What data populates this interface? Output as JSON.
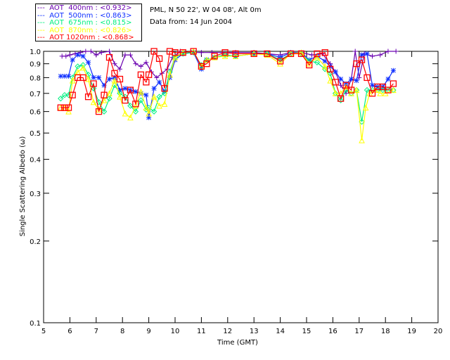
{
  "chart_data": {
    "type": "line",
    "xlabel": "Time (GMT)",
    "ylabel": "Single Scattering Albedo (ω)",
    "xlim": [
      5,
      20
    ],
    "ylim": [
      0.1,
      1.0
    ],
    "yscale": "log",
    "x_ticks": [
      "5",
      "6",
      "7",
      "8",
      "9",
      "10",
      "11",
      "12",
      "13",
      "14",
      "15",
      "16",
      "17",
      "18",
      "19",
      "20"
    ],
    "y_ticks": [
      "0.1",
      "0.2",
      "0.3",
      "0.4",
      "0.5",
      "0.6",
      "0.7",
      "0.8",
      "0.9",
      "1.0"
    ],
    "grid": false,
    "legend_position": "top-left",
    "series": [
      {
        "name": "AOT  400nm : <0.932>",
        "color": "#6a00b0",
        "marker": "plus",
        "x": [
          5.7,
          5.85,
          6.0,
          6.2,
          6.4,
          6.6,
          6.8,
          7.0,
          7.2,
          7.5,
          7.7,
          7.9,
          8.1,
          8.3,
          8.5,
          8.7,
          8.9,
          9.1,
          9.3,
          9.5,
          9.7,
          9.9,
          10.2,
          10.6,
          11.0,
          11.4,
          11.8,
          12.3,
          13.0,
          13.5,
          14.0,
          14.4,
          14.8,
          15.2,
          15.6,
          15.9,
          16.1,
          16.3,
          16.5,
          16.7,
          16.85,
          17.0,
          17.2,
          17.5,
          17.8,
          18.1,
          18.4
        ],
        "y": [
          0.96,
          0.96,
          0.97,
          0.98,
          0.99,
          1.0,
          1.0,
          0.97,
          0.99,
          1.0,
          0.9,
          0.86,
          0.97,
          0.97,
          0.9,
          0.88,
          0.91,
          0.84,
          0.8,
          0.83,
          0.86,
          0.95,
          1.0,
          0.99,
          0.99,
          0.99,
          0.99,
          0.99,
          0.99,
          0.98,
          0.97,
          0.99,
          0.99,
          0.97,
          0.98,
          0.9,
          0.84,
          0.75,
          0.7,
          0.79,
          1.0,
          0.8,
          0.98,
          0.96,
          0.97,
          1.0,
          1.0
        ]
      },
      {
        "name": "AOT  500nm : <0.863>",
        "color": "#1030ff",
        "marker": "asterisk",
        "x": [
          5.65,
          5.8,
          5.95,
          6.1,
          6.3,
          6.5,
          6.7,
          6.9,
          7.1,
          7.3,
          7.5,
          7.7,
          7.9,
          8.1,
          8.3,
          8.5,
          8.7,
          8.9,
          9.0,
          9.2,
          9.4,
          9.6,
          9.8,
          10.0,
          10.3,
          10.7,
          11.0,
          11.2,
          11.5,
          11.9,
          12.3,
          13.0,
          13.5,
          14.0,
          14.4,
          14.8,
          15.1,
          15.4,
          15.7,
          15.9,
          16.1,
          16.3,
          16.5,
          16.7,
          16.9,
          17.1,
          17.3,
          17.5,
          17.7,
          17.9,
          18.1,
          18.3
        ],
        "y": [
          0.81,
          0.81,
          0.81,
          0.93,
          0.97,
          0.96,
          0.91,
          0.8,
          0.8,
          0.75,
          0.79,
          0.8,
          0.72,
          0.73,
          0.72,
          0.71,
          0.7,
          0.69,
          0.57,
          0.73,
          0.77,
          0.71,
          0.8,
          0.93,
          0.98,
          0.99,
          0.86,
          0.93,
          0.95,
          0.97,
          0.96,
          0.98,
          0.98,
          0.95,
          0.99,
          0.99,
          0.93,
          0.96,
          0.92,
          0.88,
          0.84,
          0.79,
          0.76,
          0.79,
          0.78,
          0.97,
          0.98,
          0.75,
          0.74,
          0.74,
          0.79,
          0.85
        ]
      },
      {
        "name": "AOT  675nm : <0.815>",
        "color": "#00f080",
        "marker": "diamond",
        "x": [
          5.65,
          5.8,
          5.95,
          6.1,
          6.3,
          6.5,
          6.7,
          6.9,
          7.1,
          7.3,
          7.5,
          7.7,
          7.9,
          8.1,
          8.3,
          8.5,
          8.7,
          8.9,
          9.0,
          9.2,
          9.4,
          9.6,
          9.8,
          10.0,
          10.3,
          10.7,
          11.0,
          11.2,
          11.5,
          11.9,
          12.3,
          13.0,
          13.5,
          14.0,
          14.4,
          14.8,
          15.1,
          15.4,
          15.7,
          15.9,
          16.1,
          16.3,
          16.5,
          16.7,
          16.9,
          17.1,
          17.3,
          17.5,
          17.7,
          17.9,
          18.1,
          18.3
        ],
        "y": [
          0.67,
          0.69,
          0.69,
          0.8,
          0.88,
          0.89,
          0.82,
          0.73,
          0.65,
          0.6,
          0.67,
          0.75,
          0.7,
          0.68,
          0.63,
          0.6,
          0.66,
          0.61,
          0.62,
          0.6,
          0.68,
          0.7,
          0.84,
          0.95,
          0.98,
          0.99,
          0.89,
          0.93,
          0.95,
          0.97,
          0.96,
          0.98,
          0.98,
          0.93,
          0.98,
          0.98,
          0.92,
          0.91,
          0.86,
          0.83,
          0.7,
          0.66,
          0.72,
          0.7,
          0.72,
          0.55,
          0.72,
          0.72,
          0.72,
          0.72,
          0.72,
          0.72
        ]
      },
      {
        "name": "AOT  870nm : <0.826>",
        "color": "#ffff00",
        "marker": "triangle",
        "x": [
          5.65,
          5.8,
          5.95,
          6.1,
          6.3,
          6.5,
          6.7,
          6.9,
          7.1,
          7.3,
          7.5,
          7.7,
          7.9,
          8.1,
          8.3,
          8.5,
          8.7,
          8.9,
          9.0,
          9.2,
          9.4,
          9.6,
          9.8,
          10.0,
          10.3,
          10.7,
          11.0,
          11.2,
          11.5,
          11.9,
          12.3,
          13.0,
          13.5,
          14.0,
          14.4,
          14.8,
          15.1,
          15.4,
          15.7,
          15.9,
          16.1,
          16.3,
          16.5,
          16.7,
          16.9,
          17.1,
          17.25,
          17.4,
          17.6,
          17.8,
          18.0,
          18.3
        ],
        "y": [
          0.62,
          0.62,
          0.6,
          0.78,
          0.84,
          0.87,
          0.79,
          0.65,
          0.61,
          0.66,
          0.7,
          0.78,
          0.68,
          0.59,
          0.57,
          0.63,
          0.71,
          0.62,
          0.59,
          0.68,
          0.63,
          0.64,
          0.82,
          0.95,
          0.99,
          1.0,
          0.88,
          0.93,
          0.95,
          0.96,
          0.96,
          0.98,
          0.97,
          0.9,
          0.98,
          0.99,
          0.9,
          0.95,
          0.88,
          0.78,
          0.7,
          0.7,
          0.74,
          0.7,
          0.72,
          0.47,
          0.62,
          0.7,
          0.72,
          0.7,
          0.7,
          0.72
        ]
      },
      {
        "name": "AOT 1020nm : <0.868>",
        "color": "#ff0000",
        "marker": "square",
        "x": [
          5.65,
          5.8,
          5.95,
          6.1,
          6.3,
          6.5,
          6.7,
          6.9,
          7.1,
          7.3,
          7.5,
          7.7,
          7.9,
          8.1,
          8.3,
          8.5,
          8.7,
          8.9,
          9.0,
          9.2,
          9.4,
          9.6,
          9.8,
          10.0,
          10.3,
          10.7,
          11.0,
          11.2,
          11.5,
          11.9,
          12.3,
          13.0,
          13.5,
          14.0,
          14.4,
          14.8,
          15.1,
          15.4,
          15.7,
          15.9,
          16.1,
          16.3,
          16.5,
          16.7,
          16.9,
          17.1,
          17.3,
          17.5,
          17.7,
          17.9,
          18.1,
          18.3
        ],
        "y": [
          0.62,
          0.62,
          0.62,
          0.69,
          0.8,
          0.8,
          0.68,
          0.76,
          0.6,
          0.69,
          0.95,
          0.83,
          0.79,
          0.66,
          0.72,
          0.64,
          0.82,
          0.77,
          0.82,
          1.0,
          0.94,
          0.73,
          1.0,
          0.99,
          0.99,
          1.0,
          0.88,
          0.9,
          0.96,
          0.99,
          0.98,
          0.98,
          0.98,
          0.92,
          0.98,
          0.98,
          0.89,
          0.98,
          0.99,
          0.86,
          0.77,
          0.67,
          0.75,
          0.72,
          0.9,
          0.93,
          0.8,
          0.7,
          0.74,
          0.74,
          0.72,
          0.76
        ]
      }
    ]
  },
  "legend": [
    {
      "text": "AOT  400nm : <0.932>",
      "color": "#6a00b0"
    },
    {
      "text": "AOT  500nm : <0.863>",
      "color": "#1030ff"
    },
    {
      "text": "AOT  675nm : <0.815>",
      "color": "#00f080"
    },
    {
      "text": "AOT  870nm : <0.826>",
      "color": "#ffff00"
    },
    {
      "text": "AOT 1020nm : <0.868>",
      "color": "#ff0000"
    }
  ],
  "info": {
    "location": "PML, N 50 22', W 04 08', Alt 0m",
    "date": "Data from: 14 Jun 2004"
  }
}
